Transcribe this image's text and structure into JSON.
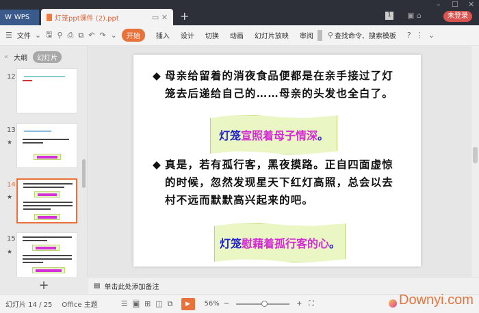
{
  "titlebar": {
    "wps_label": "WPS",
    "doc_tab": "灯笼ppt课件 (2).ppt",
    "new_tab": "+",
    "login": "未登录",
    "page_badge": "1"
  },
  "toolbar": {
    "file": "文件",
    "tabs": [
      "开始",
      "插入",
      "设计",
      "切换",
      "动画",
      "幻灯片放映",
      "审阅"
    ],
    "search": "查找命令、搜索模板",
    "help": "?"
  },
  "left_panel": {
    "outline_tab": "大纲",
    "slides_tab": "幻灯片",
    "slide_numbers": [
      "12",
      "13",
      "14",
      "15"
    ],
    "selected": "14",
    "add": "+"
  },
  "slide": {
    "bullets": [
      "母亲给留着的消夜食品便都是在亲手接过了灯笼去后递给自己的……母亲的头发也全白了。",
      "真是，若有孤行客，黑夜摸路。正自四面虚惊的时候，忽然发现星天下红灯高照，总会以去村不远而默默高兴起来的吧。"
    ],
    "banner1": {
      "blue": "灯笼",
      "magenta": "宣照着母子情深",
      "end": "。"
    },
    "banner2": {
      "blue": "灯笼",
      "magenta": "慰藉着孤行客的心",
      "end": "。"
    },
    "colors": {
      "blue": "#2222cc",
      "magenta": "#d42ad6",
      "accent": "#e8723c"
    }
  },
  "notes": {
    "placeholder": "单击此处添加备注"
  },
  "status": {
    "slide_count": "幻灯片 14 / 25",
    "theme": "Office 主题",
    "zoom": "56%",
    "zoom_fraction": 0.56
  },
  "watermark": "Downyi.com"
}
